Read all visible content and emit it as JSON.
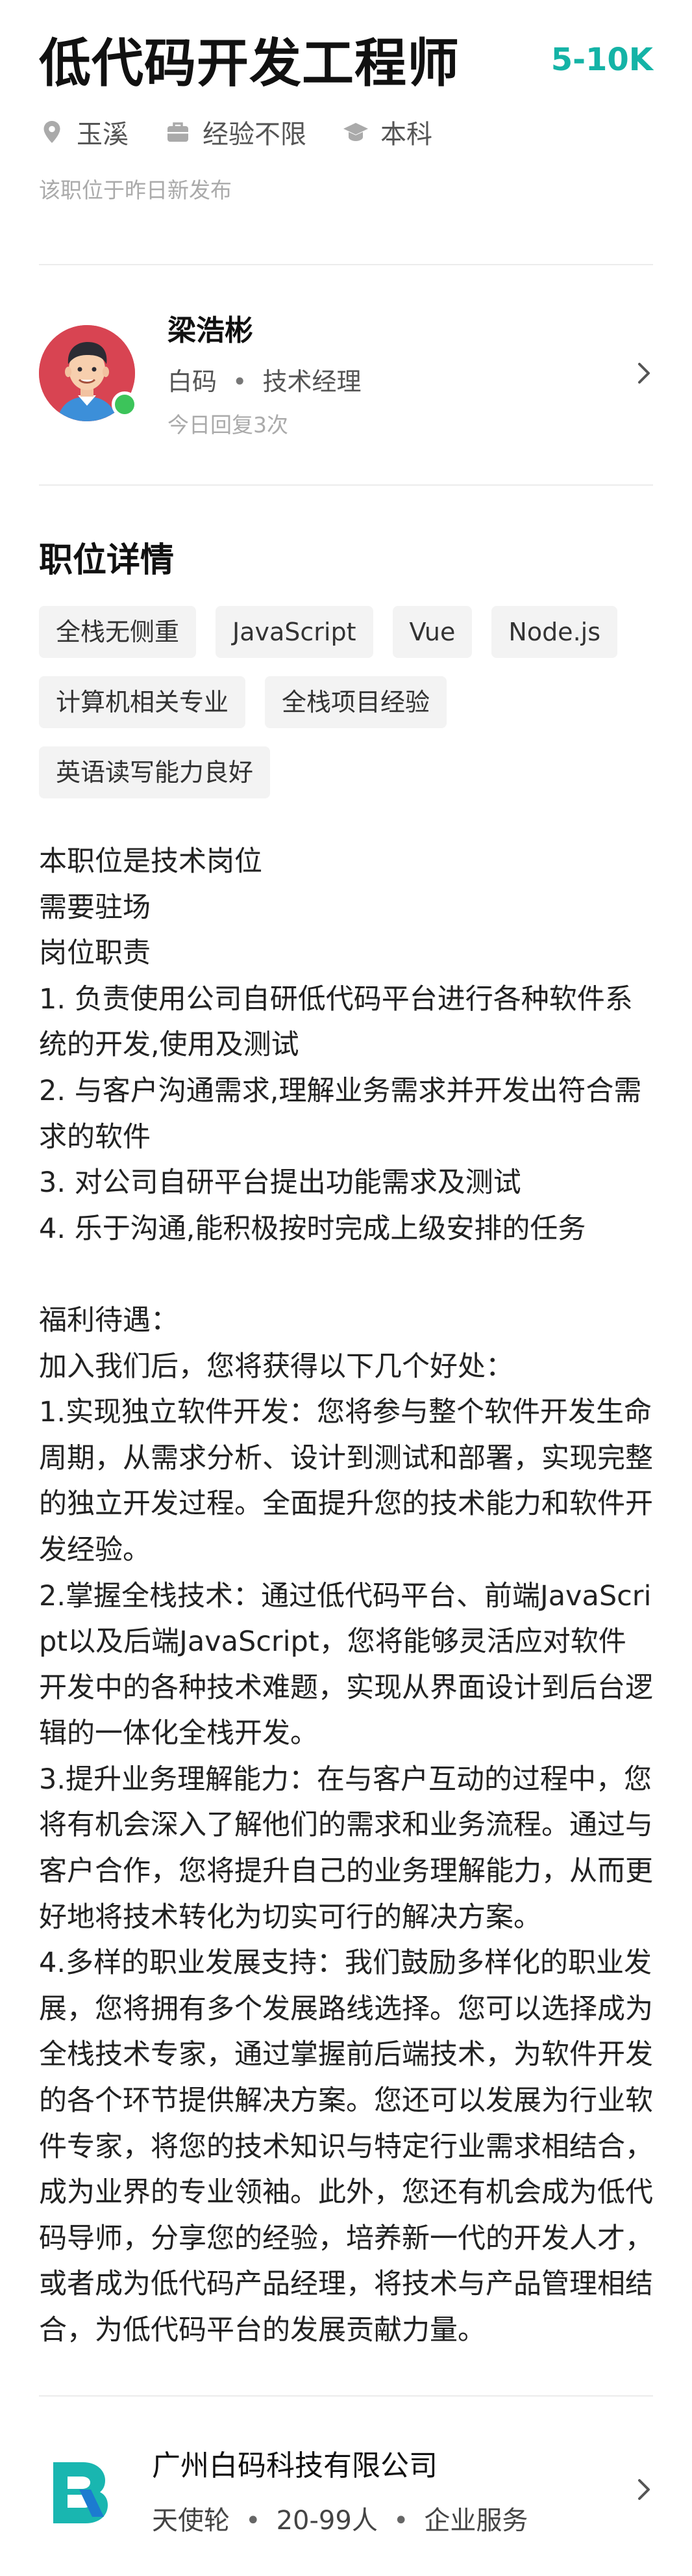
{
  "job": {
    "title": "低代码开发工程师",
    "salary": "5-10K",
    "location": "玉溪",
    "experience": "经验不限",
    "education": "本科",
    "posted": "该职位于昨日新发布"
  },
  "recruiter": {
    "name": "梁浩彬",
    "company": "白码",
    "separator": "•",
    "role": "技术经理",
    "reply_status": "今日回复3次"
  },
  "details": {
    "section_title": "职位详情",
    "tags": [
      "全栈无侧重",
      "JavaScript",
      "Vue",
      "Node.js",
      "计算机相关专业",
      "全栈项目经验",
      "英语读写能力良好"
    ],
    "description": "本职位是技术岗位\n需要驻场\n岗位职责\n1. 负责使用公司自研低代码平台进行各种软件系统的开发,使用及测试\n2. 与客户沟通需求,理解业务需求并开发出符合需求的软件\n3. 对公司自研平台提出功能需求及测试\n4. 乐于沟通,能积极按时完成上级安排的任务\n\n福利待遇：\n加入我们后，您将获得以下几个好处：\n1.实现独立软件开发：您将参与整个软件开发生命周期，从需求分析、设计到测试和部署，实现完整的独立开发过程。全面提升您的技术能力和软件开发经验。\n2.掌握全栈技术：通过低代码平台、前端JavaScript以及后端JavaScript，您将能够灵活应对软件开发中的各种技术难题，实现从界面设计到后台逻辑的一体化全栈开发。\n3.提升业务理解能力：在与客户互动的过程中，您将有机会深入了解他们的需求和业务流程。通过与客户合作，您将提升自己的业务理解能力，从而更好地将技术转化为切实可行的解决方案。\n4.多样的职业发展支持：我们鼓励多样化的职业发展，您将拥有多个发展路线选择。您可以选择成为全栈技术专家，通过掌握前后端技术，为软件开发的各个环节提供解决方案。您还可以发展为行业软件专家，将您的技术知识与特定行业需求相结合，成为业界的专业领袖。此外，您还有机会成为低代码导师，分享您的经验，培养新一代的开发人才，或者成为低代码产品经理，将技术与产品管理相结合，为低代码平台的发展贡献力量。"
  },
  "company": {
    "name": "广州白码科技有限公司",
    "funding": "天使轮",
    "size": "20-99人",
    "industry": "企业服务",
    "separator": "•"
  },
  "icons": {
    "location": "location-pin-icon",
    "experience": "briefcase-icon",
    "education": "graduation-cap-icon",
    "chevron": "chevron-right-icon",
    "logo": "company-logo-icon"
  },
  "colors": {
    "accent": "#14b3a6",
    "online": "#3cc45a",
    "avatar_bg": "#d84452",
    "logo": "#19b6b0"
  }
}
